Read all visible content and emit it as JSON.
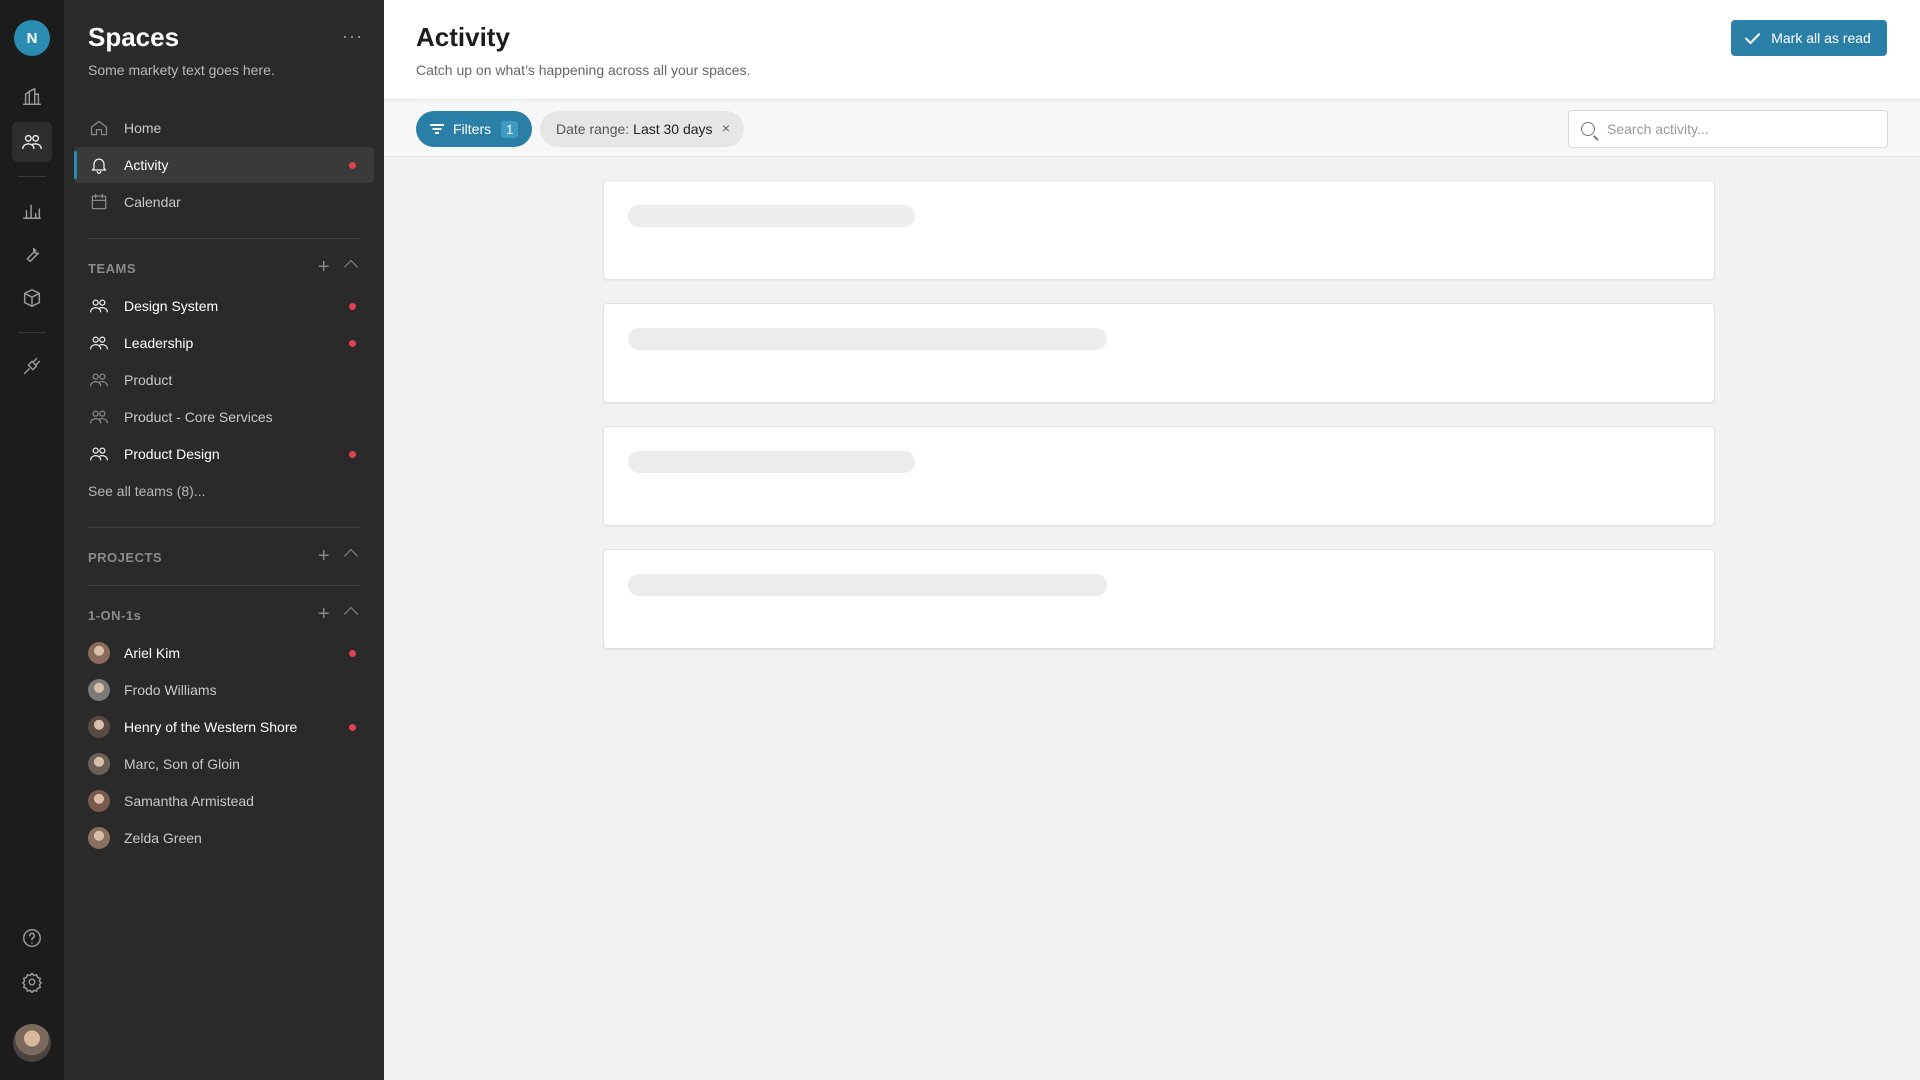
{
  "rail": {
    "avatar_initial": "N",
    "items": [
      {
        "name": "home-icon",
        "active": false
      },
      {
        "name": "people-icon",
        "active": true
      },
      {
        "name": "chart-icon",
        "active": false
      },
      {
        "name": "wrench-icon",
        "active": false
      },
      {
        "name": "box-icon",
        "active": false
      },
      {
        "name": "plug-icon",
        "active": false
      },
      {
        "name": "help-icon",
        "active": false
      },
      {
        "name": "gear-icon",
        "active": false
      }
    ]
  },
  "sidebar": {
    "title": "Spaces",
    "more": "···",
    "subtitle": "Some markety text goes here.",
    "nav": [
      {
        "label": "Home",
        "icon": "home-icon"
      },
      {
        "label": "Activity",
        "icon": "bell-icon",
        "active": true,
        "unread": true
      },
      {
        "label": "Calendar",
        "icon": "calendar-icon"
      }
    ],
    "teams": {
      "heading": "TEAMS",
      "items": [
        {
          "label": "Design System",
          "unread": true
        },
        {
          "label": "Leadership",
          "unread": true
        },
        {
          "label": "Product",
          "unread": false
        },
        {
          "label": "Product - Core Services",
          "unread": false
        },
        {
          "label": "Product Design",
          "unread": true
        }
      ],
      "see_all": "See all teams (8)..."
    },
    "projects": {
      "heading": "PROJECTS"
    },
    "one_on_ones": {
      "heading": "1-ON-1s",
      "items": [
        {
          "label": "Ariel Kim",
          "unread": true,
          "avatar_color": "#8a6a5a"
        },
        {
          "label": "Frodo Williams",
          "unread": false,
          "avatar_color": "#7a7a7a"
        },
        {
          "label": "Henry of the Western Shore",
          "unread": true,
          "avatar_color": "#5a4a44"
        },
        {
          "label": "Marc, Son of Gloin",
          "unread": false,
          "avatar_color": "#6a6058"
        },
        {
          "label": "Samantha Armistead",
          "unread": false,
          "avatar_color": "#7a5a4e"
        },
        {
          "label": "Zelda Green",
          "unread": false,
          "avatar_color": "#8a7060"
        }
      ]
    }
  },
  "header": {
    "title": "Activity",
    "subtitle": "Catch up on what’s happening across all your spaces.",
    "mark_all_label": "Mark all as read"
  },
  "toolbar": {
    "filters_label": "Filters",
    "filters_count": "1",
    "chip_key": "Date range:",
    "chip_value": "Last 30 days",
    "chip_close": "×",
    "search_placeholder": "Search activity..."
  },
  "colors": {
    "accent": "#2a7fa6",
    "unread_dot": "#e0424e"
  },
  "loading_cards": [
    {
      "skeleton_width_fraction": 0.27
    },
    {
      "skeleton_width_fraction": 0.45
    },
    {
      "skeleton_width_fraction": 0.27
    },
    {
      "skeleton_width_fraction": 0.45
    }
  ]
}
